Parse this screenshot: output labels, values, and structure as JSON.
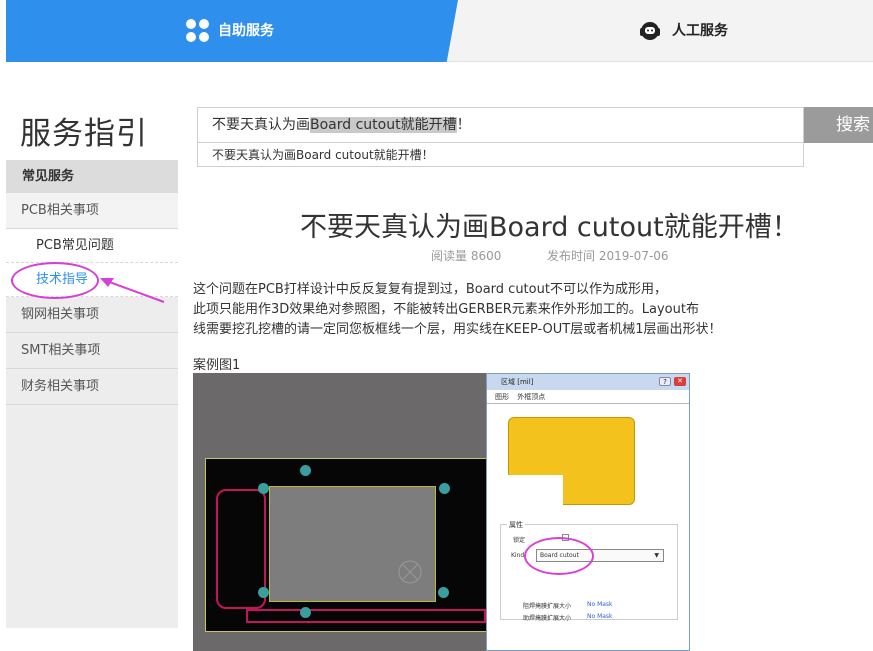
{
  "tabs": {
    "self_service": "自助服务",
    "human_service": "人工服务"
  },
  "sidebar": {
    "title": "服务指引",
    "header": "常见服务",
    "items": [
      {
        "label": "PCB相关事项",
        "children": [
          "PCB常见问题",
          "技术指导"
        ]
      },
      {
        "label": "钢网相关事项"
      },
      {
        "label": "SMT相关事项"
      },
      {
        "label": "财务相关事项"
      }
    ]
  },
  "search": {
    "value_plain": "不要天真认为画",
    "value_highlight": "Board cutout就能开槽",
    "value_tail": "！",
    "button": "搜索",
    "suggestion": "不要天真认为画Board cutout就能开槽！"
  },
  "article": {
    "title": "不要天真认为画Board cutout就能开槽！",
    "read_count": "阅读量 8600",
    "publish_date": "发布时间 2019-07-06",
    "body_lines": [
      "这个问题在PCB打样设计中反反复复有提到过，Board cutout不可以作为成形用，",
      "此项只能用作3D效果绝对参照图，不能被转出GERBER元素来作外形加工的。Layout布",
      "线需要挖孔挖槽的请一定同您板框线一个层，用实线在KEEP-OUT层或者机械1层画出形状！"
    ],
    "figure_caption": "案例图1"
  },
  "dialog": {
    "title": "区域 [mil]",
    "tabs": [
      "图形",
      "外框顶点"
    ],
    "group_label": "属性",
    "lock_label": "锁定",
    "kind_label": "Kind",
    "kind_value": "Board cutout",
    "solder_mask_label": "阻焊掩膜扩展大小",
    "paste_mask_label": "助焊掩膜扩展大小",
    "mask_value": "No Mask"
  },
  "colors": {
    "accent": "#2f8fed",
    "annotation": "#d83fd8",
    "shape_fill": "#f4c21c"
  }
}
